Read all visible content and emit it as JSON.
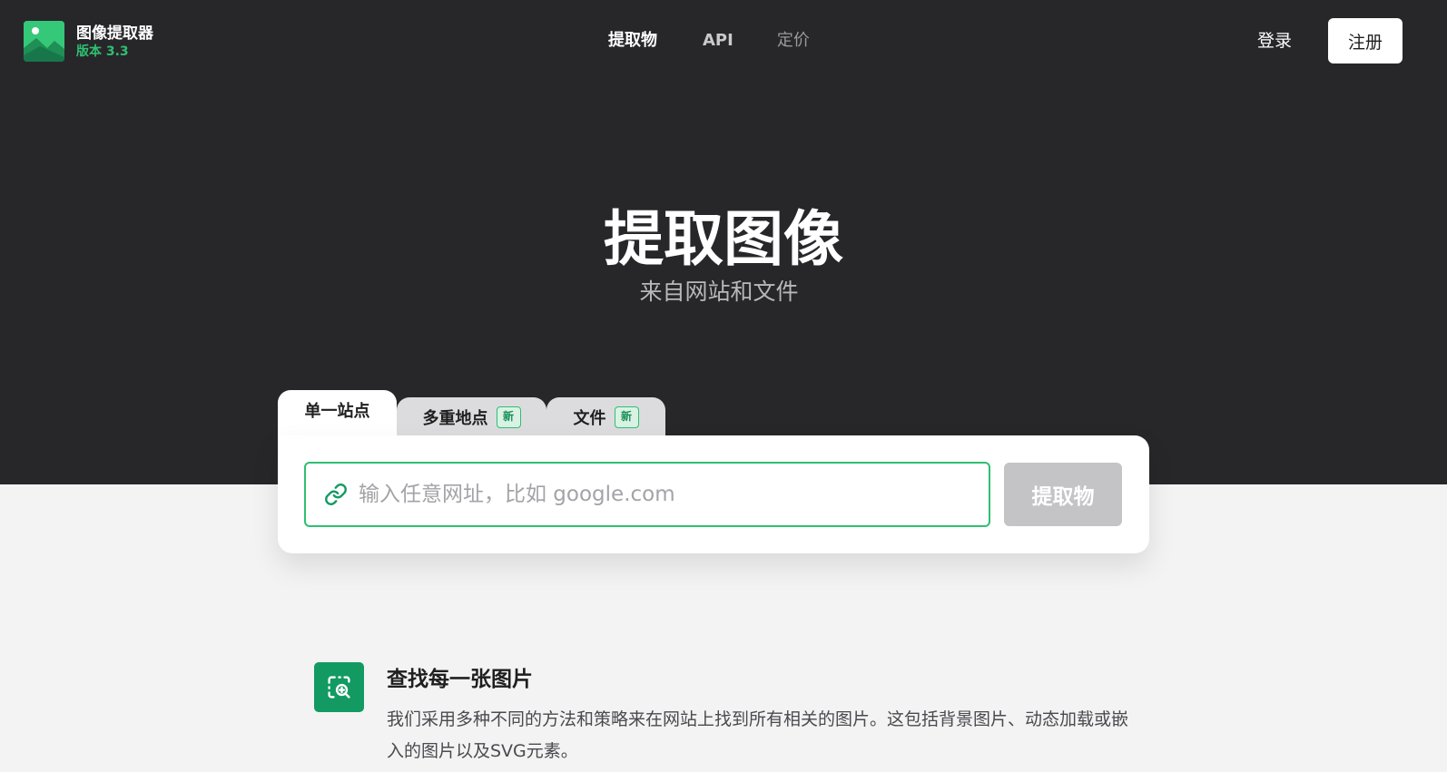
{
  "brand": {
    "name": "图像提取器",
    "version": "版本 3.3",
    "logo_icon": "mountain-image-icon",
    "accent_color": "#2fbf71"
  },
  "nav": {
    "items": [
      {
        "label": "提取物"
      },
      {
        "label": "API"
      },
      {
        "label": "定价"
      }
    ]
  },
  "auth": {
    "login_label": "登录",
    "signup_label": "注册"
  },
  "hero": {
    "title": "提取图像",
    "subtitle": "来自网站和文件"
  },
  "tabs": [
    {
      "label": "单一站点",
      "active": true
    },
    {
      "label": "多重地点",
      "badge": "新"
    },
    {
      "label": "文件",
      "badge": "新"
    }
  ],
  "search": {
    "icon": "link-icon",
    "placeholder": "输入任意网址，比如 google.com",
    "value": "",
    "button_label": "提取物"
  },
  "feature": {
    "icon": "image-search-icon",
    "title": "查找每一张图片",
    "description": "我们采用多种不同的方法和策略来在网站上找到所有相关的图片。这包括背景图片、动态加载或嵌入的图片以及SVG元素。"
  }
}
